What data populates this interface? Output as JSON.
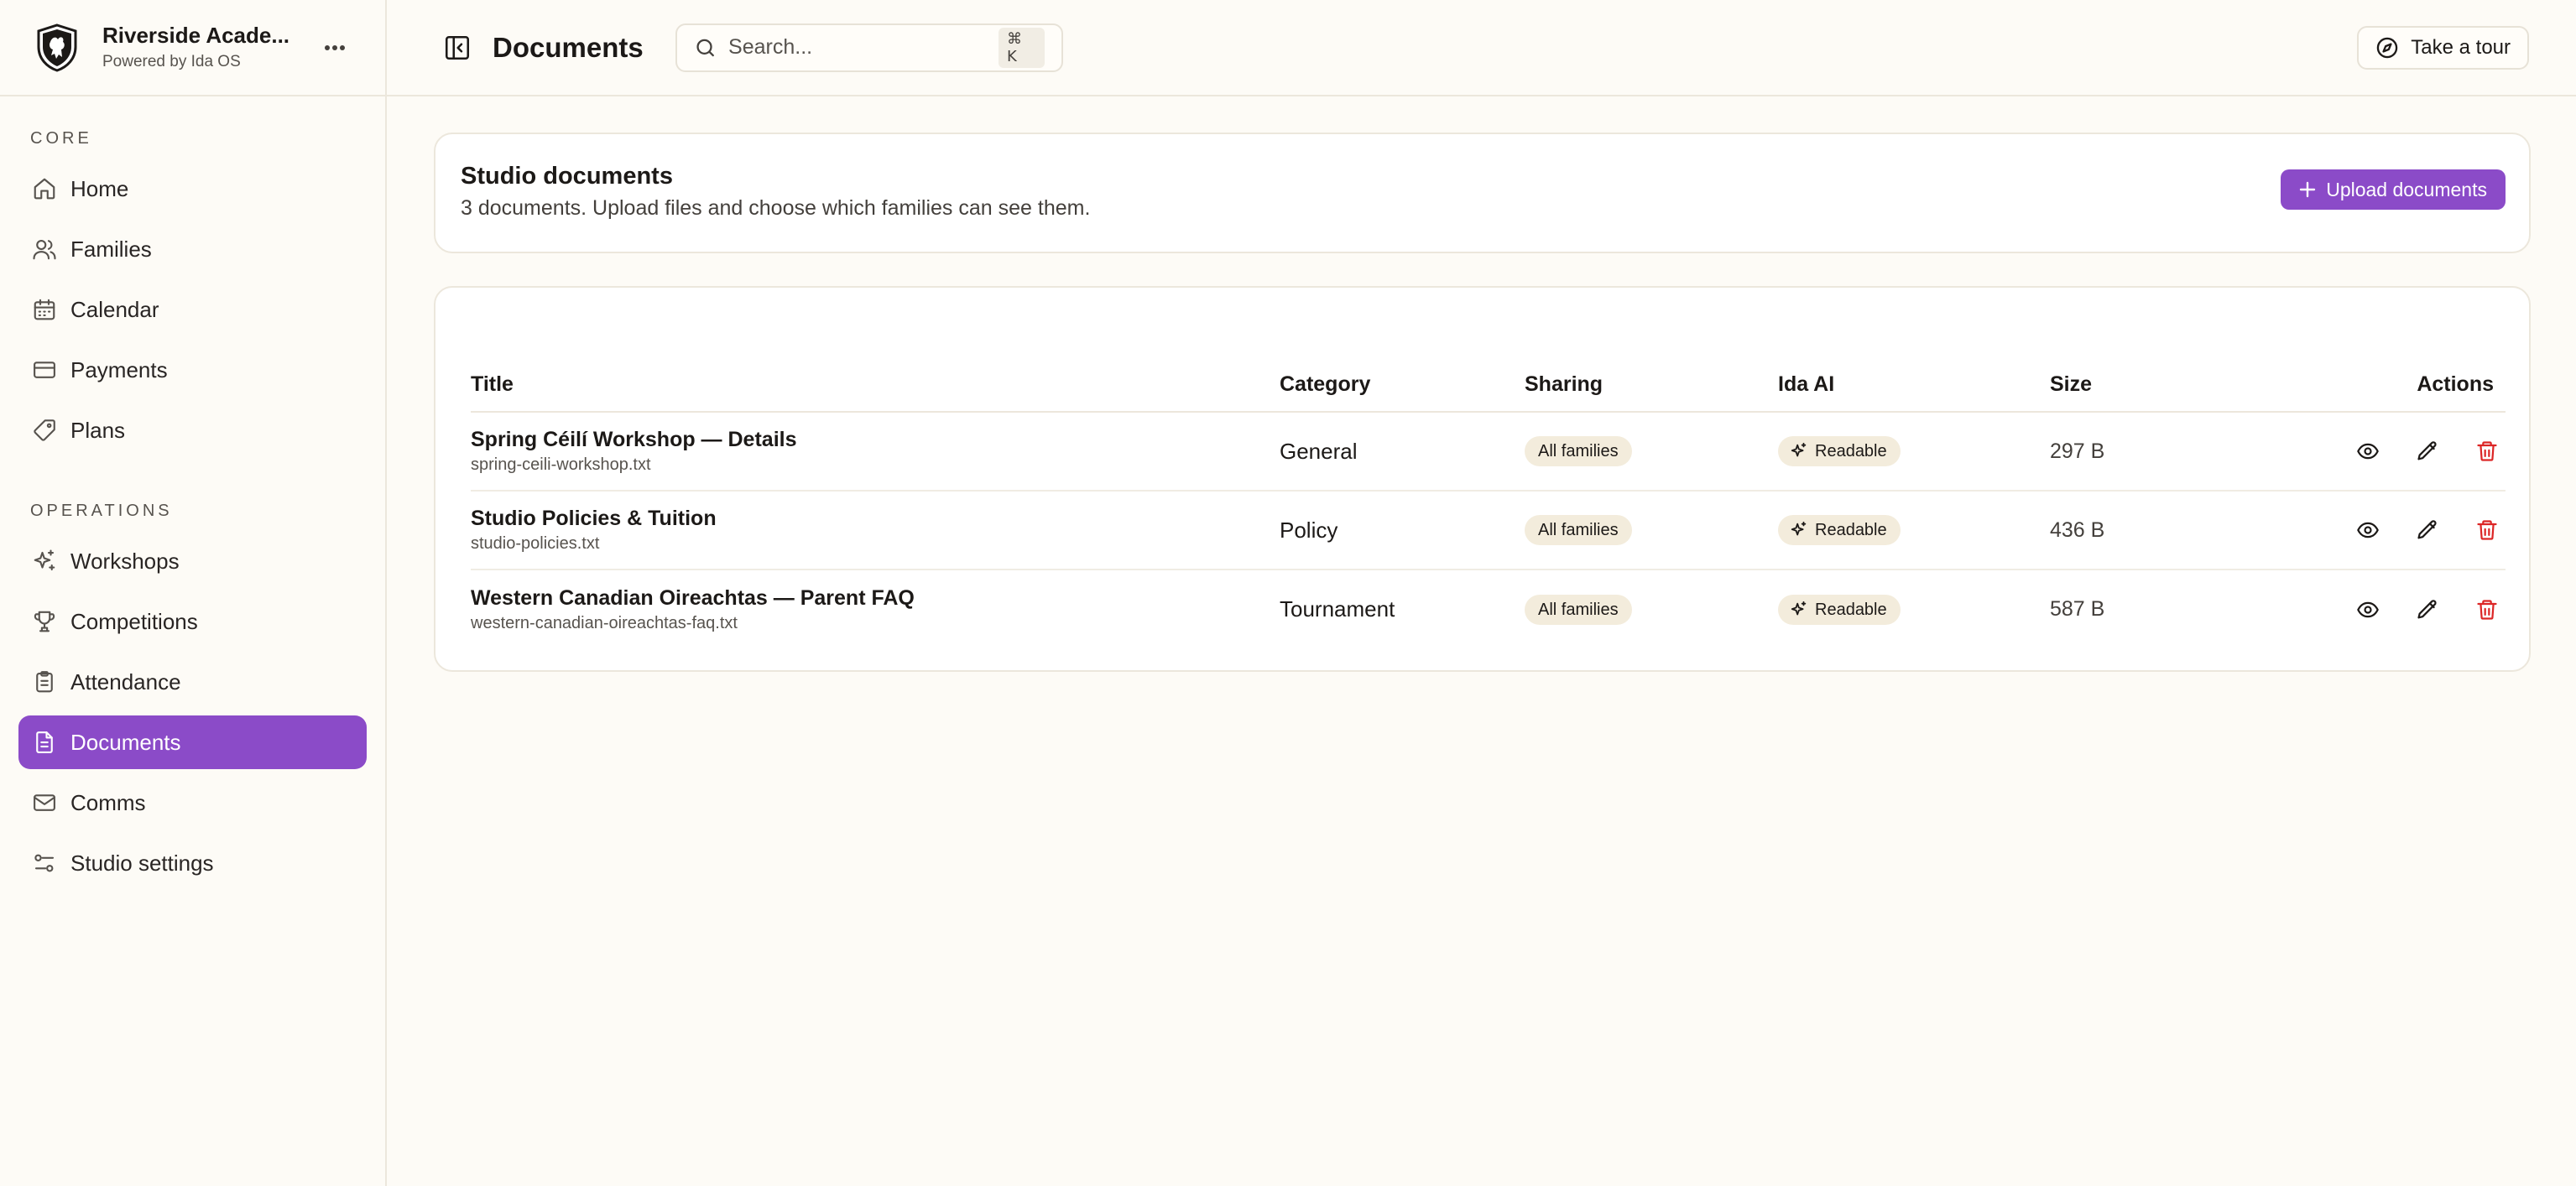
{
  "brand": {
    "name": "Riverside Acade...",
    "subtitle": "Powered by Ida OS"
  },
  "nav": {
    "sections": [
      {
        "heading": "CORE",
        "items": [
          {
            "label": "Home",
            "icon": "home-icon"
          },
          {
            "label": "Families",
            "icon": "users-icon"
          },
          {
            "label": "Calendar",
            "icon": "calendar-icon"
          },
          {
            "label": "Payments",
            "icon": "credit-card-icon"
          },
          {
            "label": "Plans",
            "icon": "tag-icon"
          }
        ]
      },
      {
        "heading": "OPERATIONS",
        "items": [
          {
            "label": "Workshops",
            "icon": "sparkles-icon"
          },
          {
            "label": "Competitions",
            "icon": "trophy-icon"
          },
          {
            "label": "Attendance",
            "icon": "clipboard-icon"
          },
          {
            "label": "Documents",
            "icon": "file-text-icon",
            "active": true
          },
          {
            "label": "Comms",
            "icon": "mail-icon"
          },
          {
            "label": "Studio settings",
            "icon": "sliders-icon"
          }
        ]
      }
    ]
  },
  "topbar": {
    "title": "Documents",
    "search_placeholder": "Search...",
    "search_shortcut": "⌘ K",
    "tour_label": "Take a tour"
  },
  "summary": {
    "title": "Studio documents",
    "subtitle": "3 documents. Upload files and choose which families can see them.",
    "upload_label": "Upload documents"
  },
  "table": {
    "columns": [
      "Title",
      "Category",
      "Sharing",
      "Ida AI",
      "Size",
      "Actions"
    ],
    "rows": [
      {
        "title": "Spring Céilí Workshop — Details",
        "file": "spring-ceili-workshop.txt",
        "category": "General",
        "sharing": "All families",
        "ai": "Readable",
        "size": "297 B"
      },
      {
        "title": "Studio Policies & Tuition",
        "file": "studio-policies.txt",
        "category": "Policy",
        "sharing": "All families",
        "ai": "Readable",
        "size": "436 B"
      },
      {
        "title": "Western Canadian Oireachtas — Parent FAQ",
        "file": "western-canadian-oireachtas-faq.txt",
        "category": "Tournament",
        "sharing": "All families",
        "ai": "Readable",
        "size": "587 B"
      }
    ]
  },
  "colors": {
    "accent": "#8b4bc8",
    "danger": "#dc2626",
    "background": "#fdfbf6",
    "pill": "#f3ecdc"
  }
}
